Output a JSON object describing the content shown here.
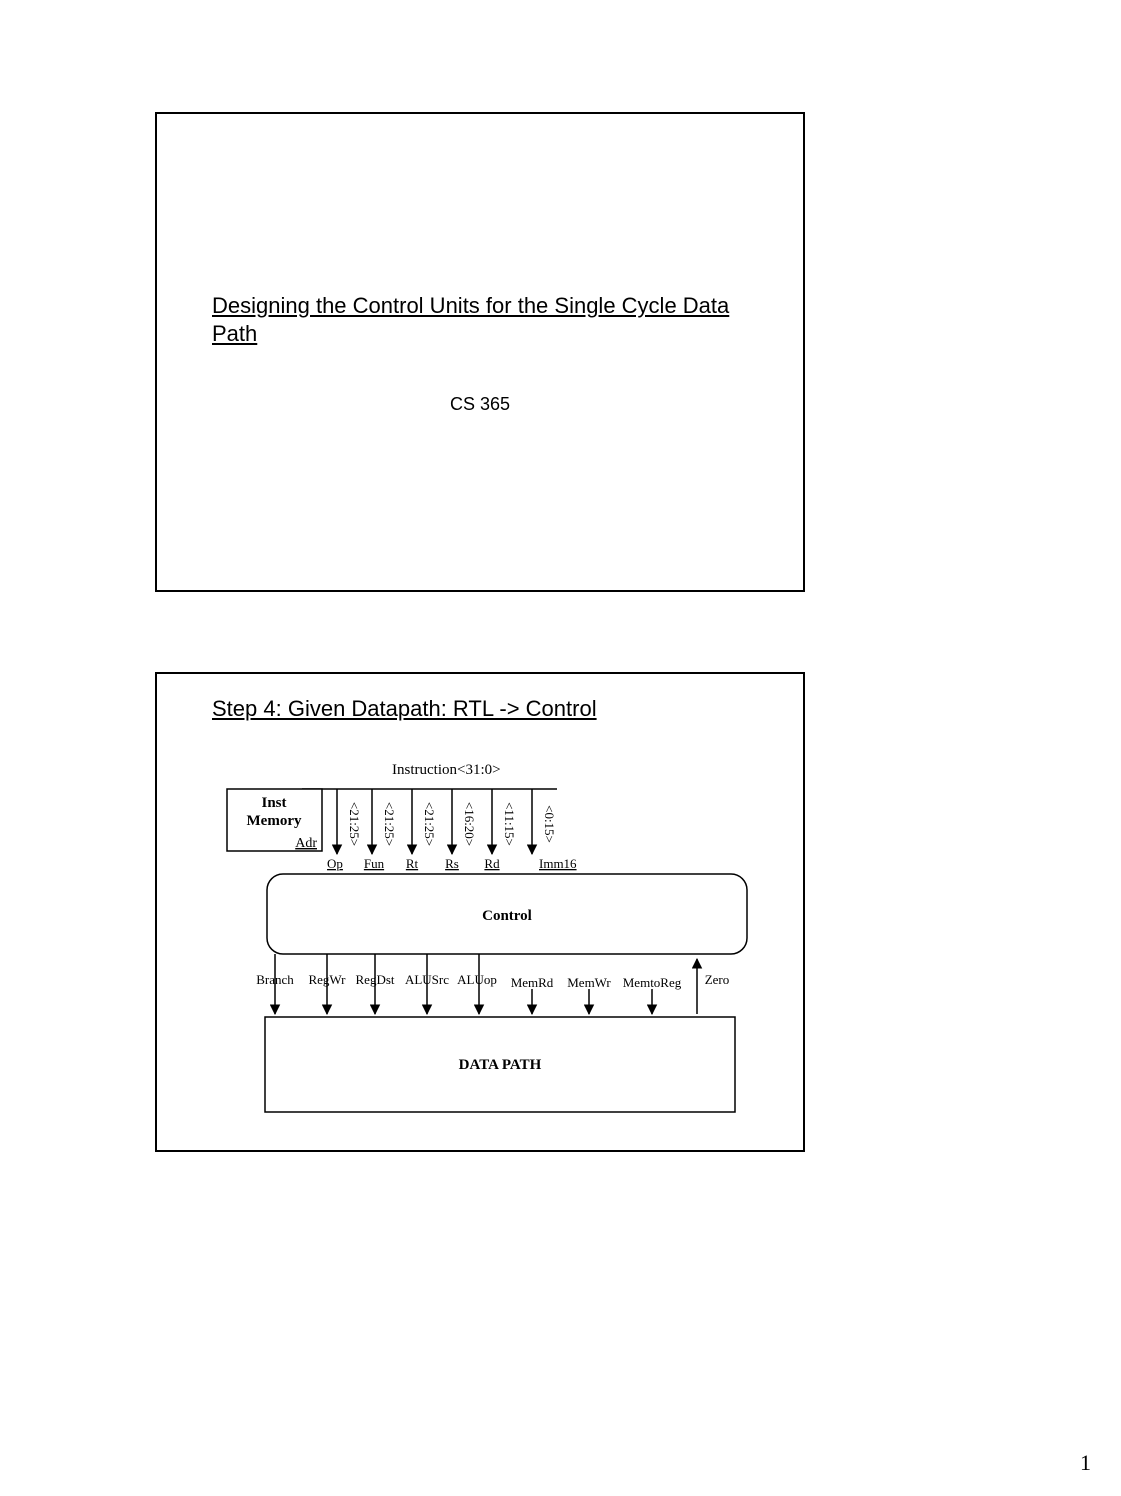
{
  "page_number": "1",
  "slide1": {
    "title": "Designing the Control Units for the Single Cycle Data Path",
    "subtitle": "CS 365"
  },
  "slide2": {
    "title": "Step 4: Given Datapath: RTL -> Control",
    "instruction_label": "Instruction<31:0>",
    "inst_mem_line1": "Inst",
    "inst_mem_line2": "Memory",
    "inst_mem_port": "Adr",
    "fields": [
      {
        "bits": "<21:25>",
        "name": "Op"
      },
      {
        "bits": "<21:25>",
        "name": "Fun"
      },
      {
        "bits": "<21:25>",
        "name": "Rt"
      },
      {
        "bits": "<16:20>",
        "name": "Rs"
      },
      {
        "bits": "<11:15>",
        "name": "Rd"
      },
      {
        "bits": "<0:15>",
        "name": "Imm16"
      }
    ],
    "control_label": "Control",
    "signals": [
      "Branch",
      "RegWr",
      "RegDst",
      "ALUSrc",
      "ALUop",
      "MemRd",
      "MemWr",
      "MemtoReg"
    ],
    "zero_label": "Zero",
    "datapath_label": "DATA PATH"
  }
}
